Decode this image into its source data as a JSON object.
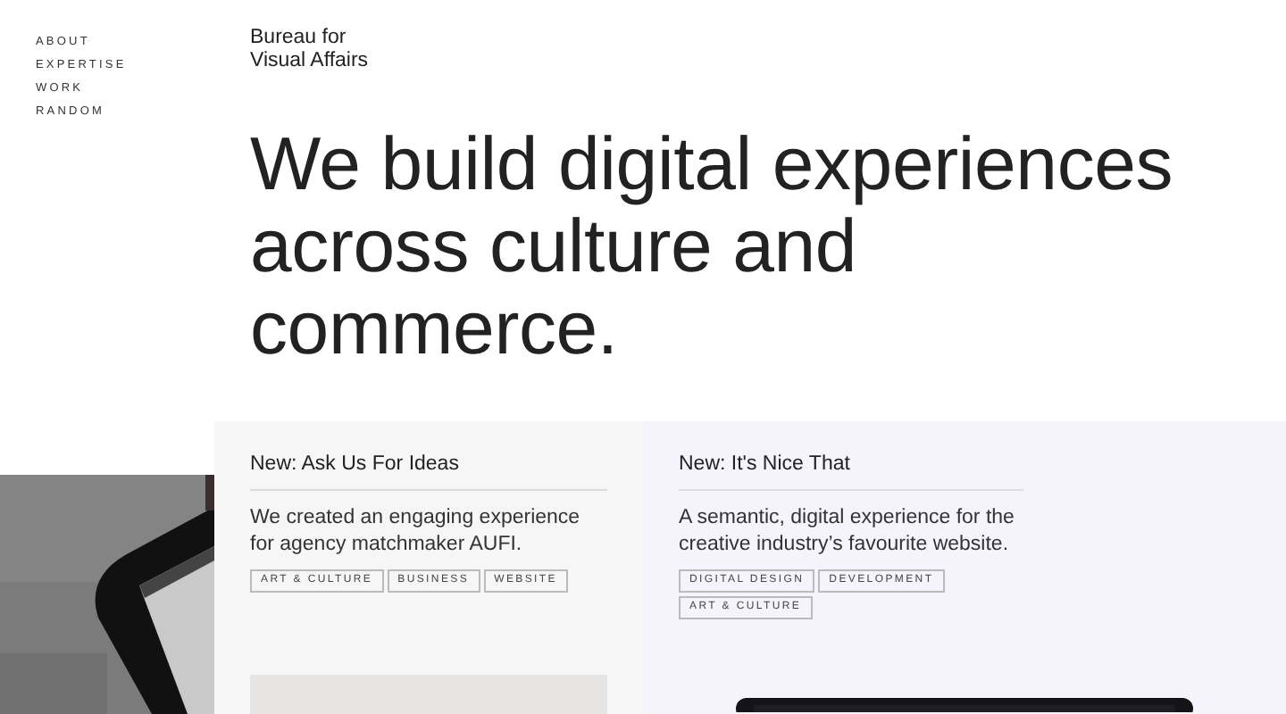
{
  "nav": {
    "items": [
      {
        "label": "ABOUT"
      },
      {
        "label": "EXPERTISE"
      },
      {
        "label": "WORK"
      },
      {
        "label": "RANDOM"
      }
    ]
  },
  "brand": {
    "lines": [
      "Bureau for",
      "Visual Affairs"
    ]
  },
  "headline": "We build digital experiences across culture and commerce.",
  "photo": {
    "kind": "picture"
  },
  "cards": [
    {
      "title": "New: Ask Us For Ideas",
      "description": "We created an engaging experience for agency matchmaker AUFI.",
      "tags": [
        "ART & CULTURE",
        "BUSINESS",
        "WEBSITE"
      ],
      "media": {
        "kind": "placeholder"
      }
    },
    {
      "title": "New: It's Nice That",
      "description": "A semantic, digital experience for the creative industry’s favourite website.",
      "tags": [
        "DIGITAL DESIGN",
        "DEVELOPMENT",
        "ART & CULTURE"
      ],
      "media": {
        "kind": "picture"
      }
    }
  ]
}
